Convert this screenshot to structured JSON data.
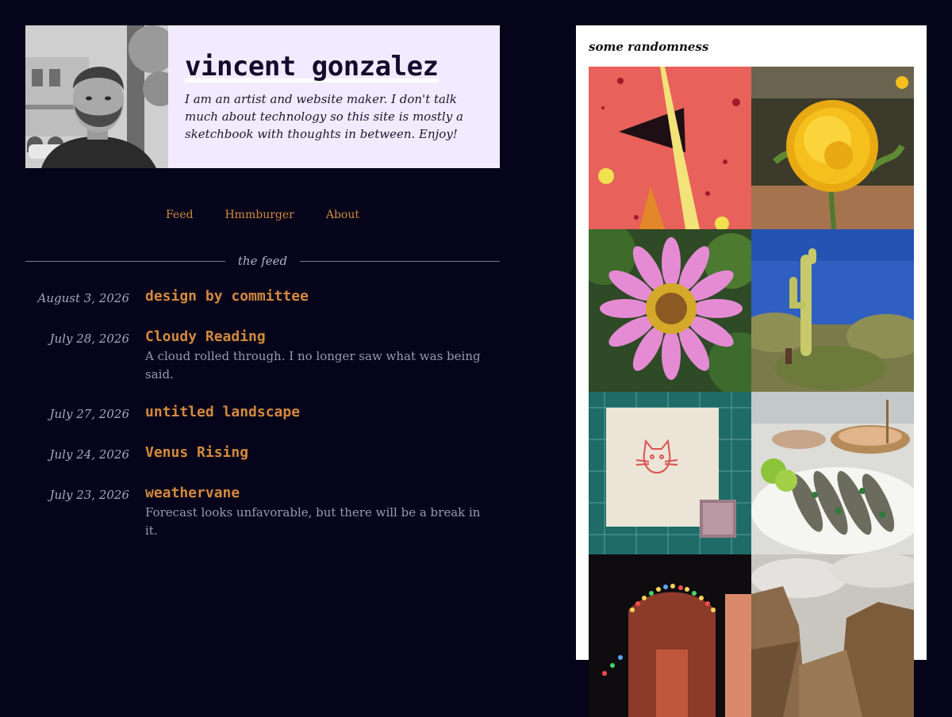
{
  "profile": {
    "name": "vincent gonzalez",
    "tagline": "I am an artist and website maker. I don't talk much about technology so this site is mostly a sketchbook with thoughts in between. Enjoy!"
  },
  "nav": [
    {
      "label": "Feed"
    },
    {
      "label": "Hmmburger"
    },
    {
      "label": "About"
    }
  ],
  "feed": {
    "heading": "the feed",
    "entries": [
      {
        "date": "August 3, 2026",
        "title": "design by committee",
        "summary": ""
      },
      {
        "date": "July 28, 2026",
        "title": "Cloudy Reading",
        "summary": "A cloud rolled through. I no longer saw what was being said."
      },
      {
        "date": "July 27, 2026",
        "title": "untitled landscape",
        "summary": ""
      },
      {
        "date": "July 24, 2026",
        "title": "Venus Rising",
        "summary": ""
      },
      {
        "date": "July 23, 2026",
        "title": "weathervane",
        "summary": "Forecast looks unfavorable, but there will be a break in it."
      }
    ]
  },
  "sidebar": {
    "heading": "some randomness",
    "photos": [
      "abstract-triangle-painting",
      "yellow-marigold",
      "pink-zinnia",
      "saguaro-cactus",
      "cat-stamp-print",
      "grilled-fish-plate",
      "string-lights-house",
      "canyon-cliffs"
    ]
  },
  "colors": {
    "background": "#05041a",
    "accent": "#d28a3e",
    "card": "#f2ebff",
    "muted_text": "#9c99ad"
  }
}
